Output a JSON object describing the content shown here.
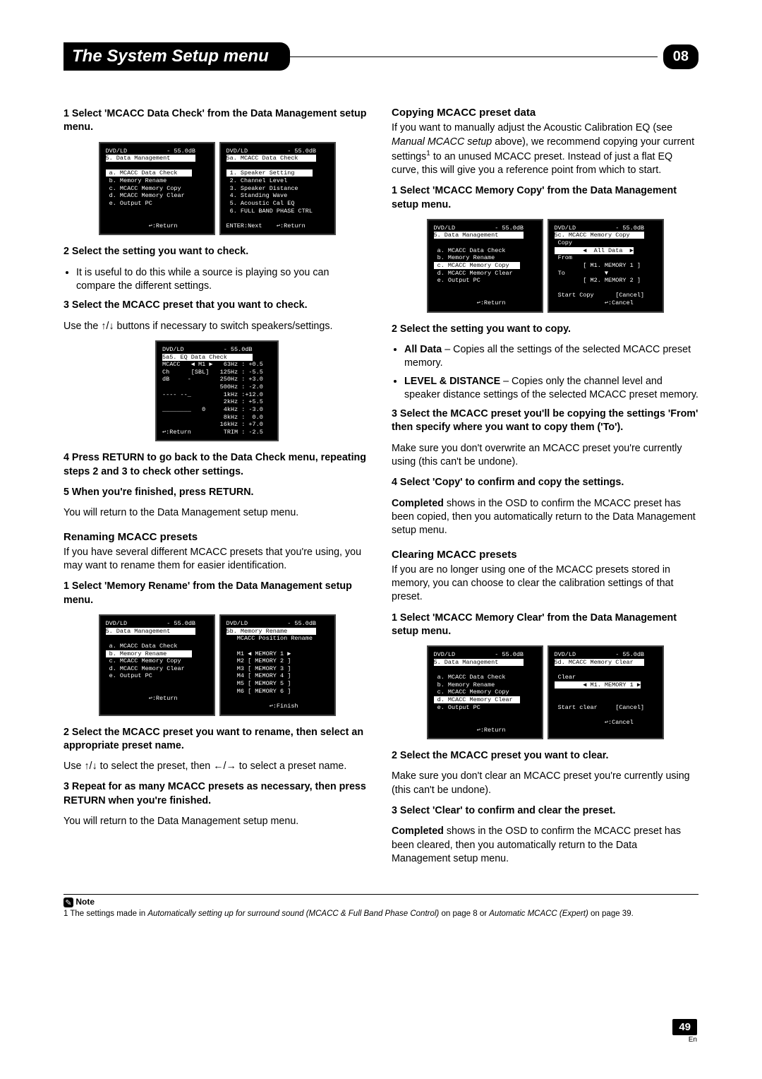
{
  "header": {
    "title": "The System Setup menu",
    "badge": "08"
  },
  "left": {
    "step1": "1   Select 'MCACC Data Check' from the Data Management setup menu.",
    "step2": "2   Select the setting you want to check.",
    "bullet2a": "It is useful to do this while a source is playing so you can compare the different settings.",
    "step3": "3   Select the MCACC preset that you want to check.",
    "step3_body_a": "Use the ",
    "step3_body_b": " buttons if necessary to switch speakers/settings.",
    "step4": "4   Press RETURN to go back to the Data Check menu, repeating steps 2 and 3 to check other settings.",
    "step5": "5   When you're finished, press RETURN.",
    "step5_body": "You will return to the Data Management setup menu.",
    "rename_heading": "Renaming MCACC presets",
    "rename_intro": "If you have several different MCACC presets that you're using, you may want to rename them for easier identification.",
    "rstep1": "1   Select 'Memory Rename' from the Data Management setup menu.",
    "rstep2": "2   Select the MCACC preset you want to rename, then select an appropriate preset name.",
    "rstep2_body_a": "Use ",
    "rstep2_body_b": " to select the preset, then ",
    "rstep2_body_c": " to select a preset name.",
    "rstep3": "3   Repeat for as many MCACC presets as necessary, then press RETURN when you're finished.",
    "rstep3_body": "You will return to the Data Management setup menu."
  },
  "right": {
    "copy_heading": "Copying MCACC preset data",
    "copy_intro_a": "If you want to manually adjust the Acoustic Calibration EQ (see ",
    "copy_intro_i": "Manual MCACC setup",
    "copy_intro_b": " above), we recommend copying your current settings",
    "copy_intro_c": " to an unused MCACC preset. Instead of just a flat EQ curve, this will give you a reference point from which to start.",
    "cstep1": "1   Select 'MCACC Memory Copy' from the Data Management setup menu.",
    "cstep2": "2   Select the setting you want to copy.",
    "cbul1_b": "All Data",
    "cbul1_t": " – Copies all the settings of the selected MCACC preset memory.",
    "cbul2_b": "LEVEL & DISTANCE",
    "cbul2_t": " – Copies only the channel level and speaker distance settings of the selected MCACC preset memory.",
    "cstep3": "3   Select the MCACC preset you'll be copying the settings 'From' then specify where you want to copy them ('To').",
    "cstep3_body": "Make sure you don't overwrite an MCACC preset you're currently using (this can't be undone).",
    "cstep4": "4   Select 'Copy' to confirm and copy the settings.",
    "cstep4_body_b": "Completed",
    "cstep4_body_t": " shows in the OSD to confirm the MCACC preset has been copied, then you automatically return to the Data Management setup menu.",
    "clear_heading": "Clearing MCACC presets",
    "clear_intro": "If you are no longer using one of the MCACC presets stored in memory, you can choose to clear the calibration settings of that preset.",
    "clstep1": "1   Select 'MCACC Memory Clear' from the Data Management setup menu.",
    "clstep2": "2   Select the MCACC preset you want to clear.",
    "clstep2_body": "Make sure you don't clear an MCACC preset you're currently using (this can't be undone).",
    "clstep3": "3   Select 'Clear' to confirm and clear the preset.",
    "clstep3_body_b": "Completed",
    "clstep3_body_t": " shows in the OSD to confirm the MCACC preset has been cleared, then you automatically return to the Data Management setup menu."
  },
  "osd": {
    "dm_header": "DVD/LD           - 55.0dB",
    "dm_title": "5. Data Management       ",
    "dm_a_hl": " a. MCACC Data Check    ",
    "dm_b": " b. Memory Rename",
    "dm_b_hl": " b. Memory Rename       ",
    "dm_c": " c. MCACC Memory Copy",
    "dm_c_hl": " c. MCACC Memory Copy   ",
    "dm_d": " d. MCACC Memory Clear",
    "dm_d_hl": " d. MCACC Memory Clear  ",
    "dm_e": " e. Output PC",
    "dm_return": "            ↩:Return",
    "dc_title": "5a. MCACC Data Check     ",
    "dc_1_hl": " 1. Speaker Setting     ",
    "dc_2": " 2. Channel Level",
    "dc_3": " 3. Speaker Distance",
    "dc_4": " 4. Standing Wave",
    "dc_5": " 5. Acoustic Cal EQ",
    "dc_6": " 6. FULL BAND PHASE CTRL",
    "dc_foot": "ENTER:Next    ↩:Return",
    "eq_title": "5a5. EQ Data Check       ",
    "eq_l1": "MCACC   ◀ M1 ▶   63Hz : +0.5",
    "eq_l2": "Ch      [SBL]   125Hz : -5.5",
    "eq_l3": "dB     -        250Hz : +3.0",
    "eq_l4": "                500Hz : -2.0",
    "eq_l5": "---- --_         1kHz :+12.0",
    "eq_l6": "                 2kHz : +5.5",
    "eq_l7": "________   0     4kHz : -3.0",
    "eq_l8": "                 8kHz :  0.0",
    "eq_l9": "                16kHz : +7.0",
    "eq_l10": "↩:Return         TRIM : -2.5",
    "rn_title": "5b. Memory Rename        ",
    "rn_sub": "   MCACC Position Rename",
    "rn_1": "   M1 ◀ MEMORY 1 ▶",
    "rn_2": "   M2 [ MEMORY 2 ]",
    "rn_3": "   M3 [ MEMORY 3 ]",
    "rn_4": "   M4 [ MEMORY 4 ]",
    "rn_5": "   M5 [ MEMORY 5 ]",
    "rn_6": "   M6 [ MEMORY 6 ]",
    "rn_foot": "            ↩:Finish",
    "cp_title": "5c. MCACC Memory Copy    ",
    "cp_copy": " Copy",
    "cp_data": "        ◀  All Data  ▶",
    "cp_from": " From",
    "cp_from_v": "        [ M1. MEMORY 1 ]",
    "cp_to": " To           ▼",
    "cp_to_v": "        [ M2. MEMORY 2 ]",
    "cp_foot1": " Start Copy      [Cancel]",
    "cp_foot2": "              ↩:Cancel",
    "cl_title": "5d. MCACC Memory Clear   ",
    "cl_clear": " Clear",
    "cl_val": "        ◀ M1. MEMORY 1 ▶",
    "cl_foot1": " Start clear     [Cancel]",
    "cl_foot2": "              ↩:Cancel"
  },
  "footnote": {
    "label": "Note",
    "text_a": "1 The settings made in ",
    "text_i1": "Automatically setting up for surround sound (MCACC & Full Band Phase Control)",
    "text_b": " on page 8 or ",
    "text_i2": "Automatic MCACC (Expert)",
    "text_c": " on page 39."
  },
  "page": {
    "num": "49",
    "lang": "En"
  }
}
